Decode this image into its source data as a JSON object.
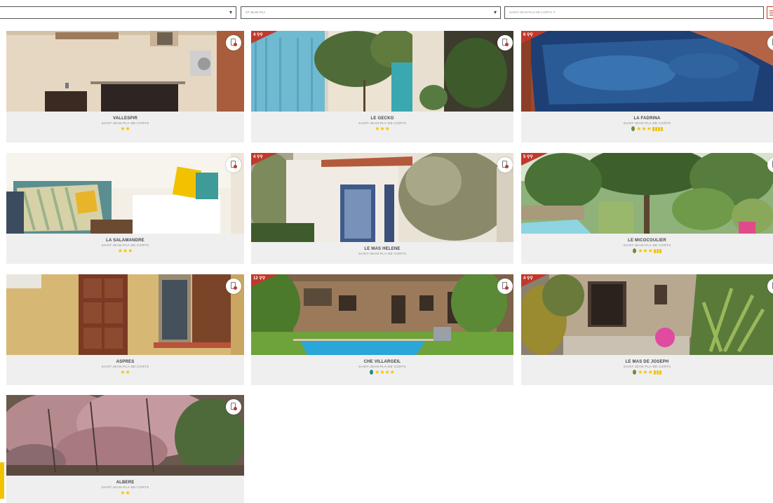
{
  "filters": {
    "select1": {
      "value": ""
    },
    "select2": {
      "value": "ST JEAN PLA"
    },
    "select3": {
      "chip": "SAINT-JEAN-PLA-DE-CORTS ✕"
    }
  },
  "cards": [
    {
      "name": "VALLESPIR",
      "town": "SAINT-JEAN-PLA-DE-CORTS",
      "stars": "★★",
      "ribbon": "",
      "eco": false,
      "epis": 0
    },
    {
      "name": "LE GECKO",
      "town": "SAINT-JEAN-PLA-DE-CORTS",
      "stars": "★★★",
      "ribbon": "4 ⚲⚲",
      "eco": false,
      "epis": 0
    },
    {
      "name": "LA FADRINA",
      "town": "SAINT-JEAN-PLA-DE-CORTS",
      "stars": "★★★",
      "ribbon": "6 ⚲⚲",
      "eco": true,
      "epis": 4
    },
    {
      "name": "LA SALAMANDRE",
      "town": "SAINT-JEAN-PLA-DE-CORTS",
      "stars": "★★★",
      "ribbon": "",
      "eco": false,
      "epis": 0
    },
    {
      "name": "LE MAS HELENE",
      "town": "SAINT-JEAN-PLA-DE-CORTS",
      "stars": "",
      "ribbon": "4 ⚲⚲",
      "eco": false,
      "epis": 0
    },
    {
      "name": "LE MICOCOULIER",
      "town": "SAINT-JEAN-PLA-DE-CORTS",
      "stars": "★★★",
      "ribbon": "5 ⚲⚲",
      "eco": true,
      "epis": 3
    },
    {
      "name": "ASPRES",
      "town": "SAINT-JEAN-PLA-DE-CORTS",
      "stars": "★★",
      "ribbon": "",
      "eco": false,
      "epis": 0
    },
    {
      "name": "CHE VILLARGEIL",
      "town": "SAINT-JEAN-PLA-DE-CORTS",
      "stars": "★★★★",
      "ribbon": "12 ⚲⚲",
      "eco": true,
      "epis": 0
    },
    {
      "name": "LE MAS DE JOSEPH",
      "town": "SAINT-JEAN-PLA-DE-CORTS",
      "stars": "★★★",
      "ribbon": "4 ⚲⚲",
      "eco": true,
      "epis": 3
    },
    {
      "name": "ALBERE",
      "town": "SAINT-JEAN-PLA-DE-CORTS",
      "stars": "★★",
      "ribbon": "",
      "eco": false,
      "epis": 0
    }
  ],
  "colors": {
    "ribbon": "#c0392b",
    "star": "#f2c200",
    "card_bg": "#efefef"
  }
}
